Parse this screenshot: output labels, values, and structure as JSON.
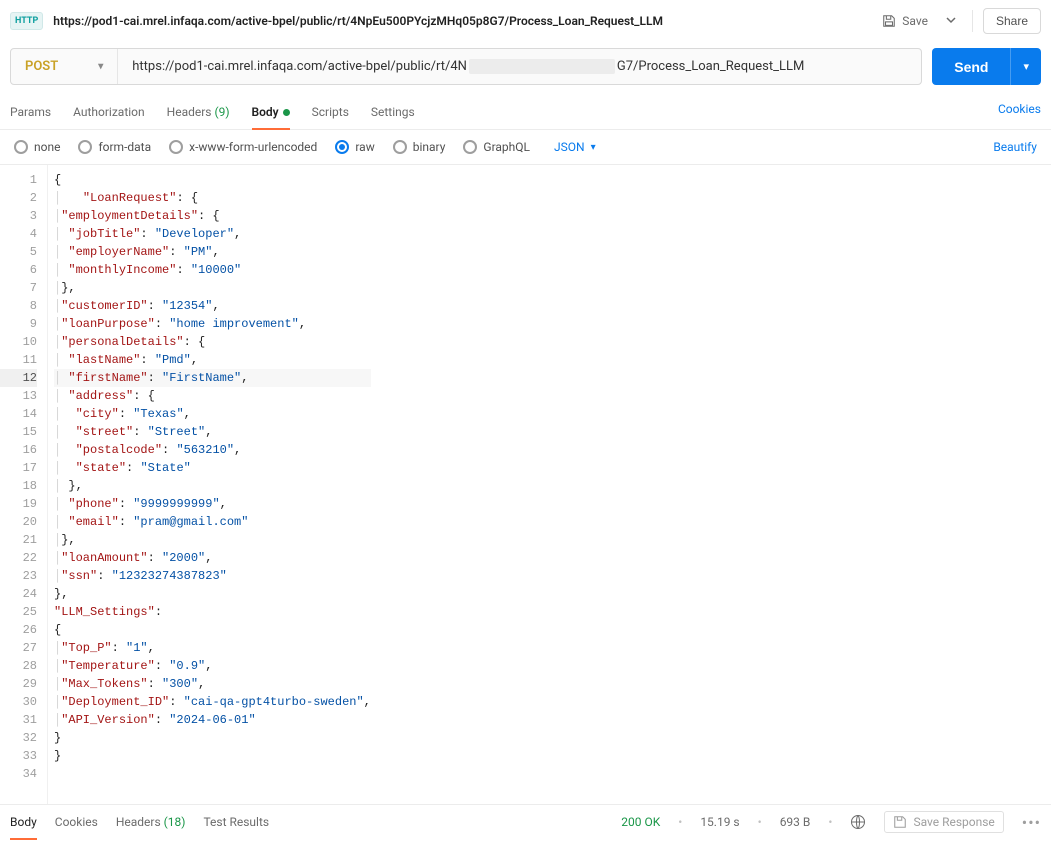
{
  "topbar": {
    "title": "https://pod1-cai.mrel.infaqa.com/active-bpel/public/rt/4NpEu500PYcjzMHq05p8G7/Process_Loan_Request_LLM",
    "save": "Save",
    "share": "Share"
  },
  "request": {
    "method": "POST",
    "url_prefix": "https://pod1-cai.mrel.infaqa.com/active-bpel/public/rt/4N",
    "url_suffix": "G7/Process_Loan_Request_LLM",
    "send": "Send"
  },
  "tabs": {
    "params": "Params",
    "auth": "Authorization",
    "headers": "Headers",
    "headers_count": "(9)",
    "body": "Body",
    "scripts": "Scripts",
    "settings": "Settings",
    "cookies": "Cookies"
  },
  "body_types": {
    "none": "none",
    "form_data": "form-data",
    "urlenc": "x-www-form-urlencoded",
    "raw": "raw",
    "binary": "binary",
    "graphql": "GraphQL",
    "lang": "JSON",
    "beautify": "Beautify"
  },
  "editor": {
    "lines": [
      [
        [
          "p",
          "{"
        ]
      ],
      [
        [
          "g",
          "│   "
        ],
        [
          "k",
          "\"LoanRequest\""
        ],
        [
          "p",
          ": {"
        ]
      ],
      [
        [
          "g",
          "│"
        ],
        [
          "k",
          "\"employmentDetails\""
        ],
        [
          "p",
          ": {"
        ]
      ],
      [
        [
          "g",
          "│ "
        ],
        [
          "k",
          "\"jobTitle\""
        ],
        [
          "p",
          ": "
        ],
        [
          "s",
          "\"Developer\""
        ],
        [
          "p",
          ","
        ]
      ],
      [
        [
          "g",
          "│ "
        ],
        [
          "k",
          "\"employerName\""
        ],
        [
          "p",
          ": "
        ],
        [
          "s",
          "\"PM\""
        ],
        [
          "p",
          ","
        ]
      ],
      [
        [
          "g",
          "│ "
        ],
        [
          "k",
          "\"monthlyIncome\""
        ],
        [
          "p",
          ": "
        ],
        [
          "s",
          "\"10000\""
        ]
      ],
      [
        [
          "g",
          "│"
        ],
        [
          "p",
          "},"
        ]
      ],
      [
        [
          "g",
          "│"
        ],
        [
          "k",
          "\"customerID\""
        ],
        [
          "p",
          ": "
        ],
        [
          "s",
          "\"12354\""
        ],
        [
          "p",
          ","
        ]
      ],
      [
        [
          "g",
          "│"
        ],
        [
          "k",
          "\"loanPurpose\""
        ],
        [
          "p",
          ": "
        ],
        [
          "s",
          "\"home improvement\""
        ],
        [
          "p",
          ","
        ]
      ],
      [
        [
          "g",
          "│"
        ],
        [
          "k",
          "\"personalDetails\""
        ],
        [
          "p",
          ": {"
        ]
      ],
      [
        [
          "g",
          "│ "
        ],
        [
          "k",
          "\"lastName\""
        ],
        [
          "p",
          ": "
        ],
        [
          "s",
          "\"Pmd\""
        ],
        [
          "p",
          ","
        ]
      ],
      [
        [
          "g",
          "│ "
        ],
        [
          "k",
          "\"firstName\""
        ],
        [
          "p",
          ": "
        ],
        [
          "s",
          "\"FirstName\""
        ],
        [
          "p",
          ","
        ]
      ],
      [
        [
          "g",
          "│ "
        ],
        [
          "k",
          "\"address\""
        ],
        [
          "p",
          ": {"
        ]
      ],
      [
        [
          "g",
          "│  "
        ],
        [
          "k",
          "\"city\""
        ],
        [
          "p",
          ": "
        ],
        [
          "s",
          "\"Texas\""
        ],
        [
          "p",
          ","
        ]
      ],
      [
        [
          "g",
          "│  "
        ],
        [
          "k",
          "\"street\""
        ],
        [
          "p",
          ": "
        ],
        [
          "s",
          "\"Street\""
        ],
        [
          "p",
          ","
        ]
      ],
      [
        [
          "g",
          "│  "
        ],
        [
          "k",
          "\"postalcode\""
        ],
        [
          "p",
          ": "
        ],
        [
          "s",
          "\"563210\""
        ],
        [
          "p",
          ","
        ]
      ],
      [
        [
          "g",
          "│  "
        ],
        [
          "k",
          "\"state\""
        ],
        [
          "p",
          ": "
        ],
        [
          "s",
          "\"State\""
        ]
      ],
      [
        [
          "g",
          "│ "
        ],
        [
          "p",
          "},"
        ]
      ],
      [
        [
          "g",
          "│ "
        ],
        [
          "k",
          "\"phone\""
        ],
        [
          "p",
          ": "
        ],
        [
          "s",
          "\"9999999999\""
        ],
        [
          "p",
          ","
        ]
      ],
      [
        [
          "g",
          "│ "
        ],
        [
          "k",
          "\"email\""
        ],
        [
          "p",
          ": "
        ],
        [
          "s",
          "\"pram@gmail.com\""
        ]
      ],
      [
        [
          "g",
          "│"
        ],
        [
          "p",
          "},"
        ]
      ],
      [
        [
          "g",
          "│"
        ],
        [
          "k",
          "\"loanAmount\""
        ],
        [
          "p",
          ": "
        ],
        [
          "s",
          "\"2000\""
        ],
        [
          "p",
          ","
        ]
      ],
      [
        [
          "g",
          "│"
        ],
        [
          "k",
          "\"ssn\""
        ],
        [
          "p",
          ": "
        ],
        [
          "s",
          "\"12323274387823\""
        ]
      ],
      [
        [
          "p",
          "},"
        ]
      ],
      [
        [
          "k",
          "\"LLM_Settings\""
        ],
        [
          "p",
          ":"
        ]
      ],
      [
        [
          "p",
          "{"
        ]
      ],
      [
        [
          "g",
          "│"
        ],
        [
          "k",
          "\"Top_P\""
        ],
        [
          "p",
          ": "
        ],
        [
          "s",
          "\"1\""
        ],
        [
          "p",
          ","
        ]
      ],
      [
        [
          "g",
          "│"
        ],
        [
          "k",
          "\"Temperature\""
        ],
        [
          "p",
          ": "
        ],
        [
          "s",
          "\"0.9\""
        ],
        [
          "p",
          ","
        ]
      ],
      [
        [
          "g",
          "│"
        ],
        [
          "k",
          "\"Max_Tokens\""
        ],
        [
          "p",
          ": "
        ],
        [
          "s",
          "\"300\""
        ],
        [
          "p",
          ","
        ]
      ],
      [
        [
          "g",
          "│"
        ],
        [
          "k",
          "\"Deployment_ID\""
        ],
        [
          "p",
          ": "
        ],
        [
          "s",
          "\"cai-qa-gpt4turbo-sweden\""
        ],
        [
          "p",
          ","
        ]
      ],
      [
        [
          "g",
          "│"
        ],
        [
          "k",
          "\"API_Version\""
        ],
        [
          "p",
          ": "
        ],
        [
          "s",
          "\"2024-06-01\""
        ]
      ],
      [
        [
          "p",
          "}"
        ]
      ],
      [
        [
          "p",
          "}"
        ]
      ],
      [
        [
          "p",
          ""
        ]
      ]
    ],
    "highlight_line": 12
  },
  "response": {
    "tabs": {
      "body": "Body",
      "cookies": "Cookies",
      "headers": "Headers",
      "headers_count": "(18)",
      "tests": "Test Results"
    },
    "status_code": "200",
    "status_text": "OK",
    "time": "15.19 s",
    "size": "693 B",
    "save_response": "Save Response"
  }
}
